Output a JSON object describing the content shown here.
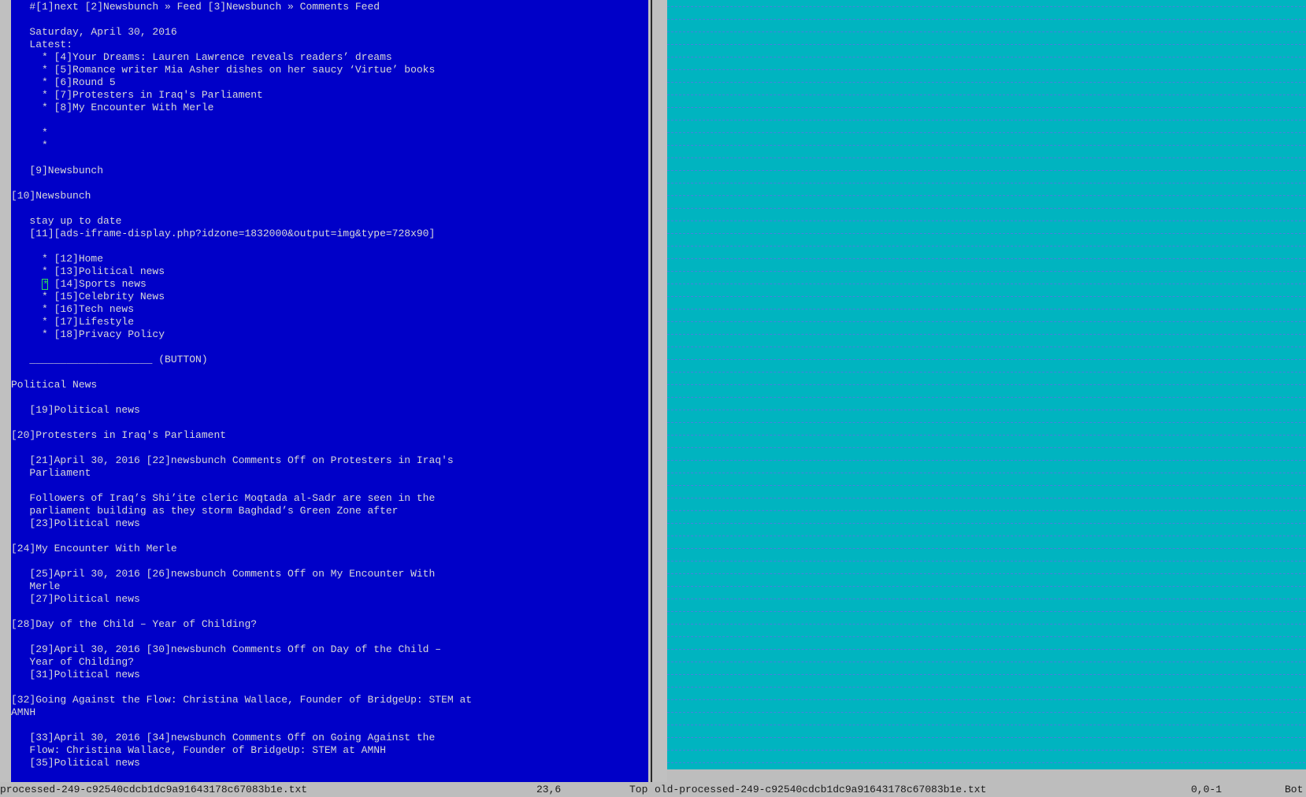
{
  "left_pane": {
    "lines": [
      "   #[1]next [2]Newsbunch » Feed [3]Newsbunch » Comments Feed",
      "",
      "   Saturday, April 30, 2016",
      "   Latest:",
      "     * [4]Your Dreams: Lauren Lawrence reveals readers’ dreams",
      "     * [5]Romance writer Mia Asher dishes on her saucy ‘Virtue’ books",
      "     * [6]Round 5",
      "     * [7]Protesters in Iraq's Parliament",
      "     * [8]My Encounter With Merle",
      "",
      "     *",
      "     *",
      "",
      "   [9]Newsbunch",
      "",
      "[10]Newsbunch",
      "",
      "   stay up to date",
      "   [11][ads-iframe-display.php?idzone=1832000&output=img&type=728x90]",
      "",
      "     * [12]Home",
      "     * [13]Political news",
      "     * [14]Sports news",
      "     * [15]Celebrity News",
      "     * [16]Tech news",
      "     * [17]Lifestyle",
      "     * [18]Privacy Policy",
      "",
      "   ____________________ (BUTTON)",
      "",
      "Political News",
      "",
      "   [19]Political news",
      "",
      "[20]Protesters in Iraq's Parliament",
      "",
      "   [21]April 30, 2016 [22]newsbunch Comments Off on Protesters in Iraq's",
      "   Parliament",
      "",
      "   Followers of Iraq’s Shi’ite cleric Moqtada al-Sadr are seen in the",
      "   parliament building as they storm Baghdad’s Green Zone after",
      "   [23]Political news",
      "",
      "[24]My Encounter With Merle",
      "",
      "   [25]April 30, 2016 [26]newsbunch Comments Off on My Encounter With",
      "   Merle",
      "   [27]Political news",
      "",
      "[28]Day of the Child – Year of Childing?",
      "",
      "   [29]April 30, 2016 [30]newsbunch Comments Off on Day of the Child –",
      "   Year of Childing?",
      "   [31]Political news",
      "",
      "[32]Going Against the Flow: Christina Wallace, Founder of BridgeUp: STEM at",
      "AMNH",
      "",
      "   [33]April 30, 2016 [34]newsbunch Comments Off on Going Against the",
      "   Flow: Christina Wallace, Founder of BridgeUp: STEM at AMNH",
      "   [35]Political news"
    ],
    "cursor_line_prefix": "     ",
    "cursor_char": "*",
    "cursor_line_rest": " [14]Sports news"
  },
  "status_bar": {
    "left_filename": "processed-249-c92540cdcb1dc9a91643178c67083b1e.txt",
    "left_position": "23,6",
    "left_scroll": "Top",
    "right_filename": "old-processed-249-c92540cdcb1dc9a91643178c67083b1e.txt",
    "right_position": "0,0-1",
    "right_scroll": "Bot"
  },
  "colors": {
    "left_background": "#0000c8",
    "right_background": "#00b4c0",
    "text": "#d8d8d8",
    "cursor": "#2ee05a",
    "filler_dash": "#4a7fe0"
  }
}
